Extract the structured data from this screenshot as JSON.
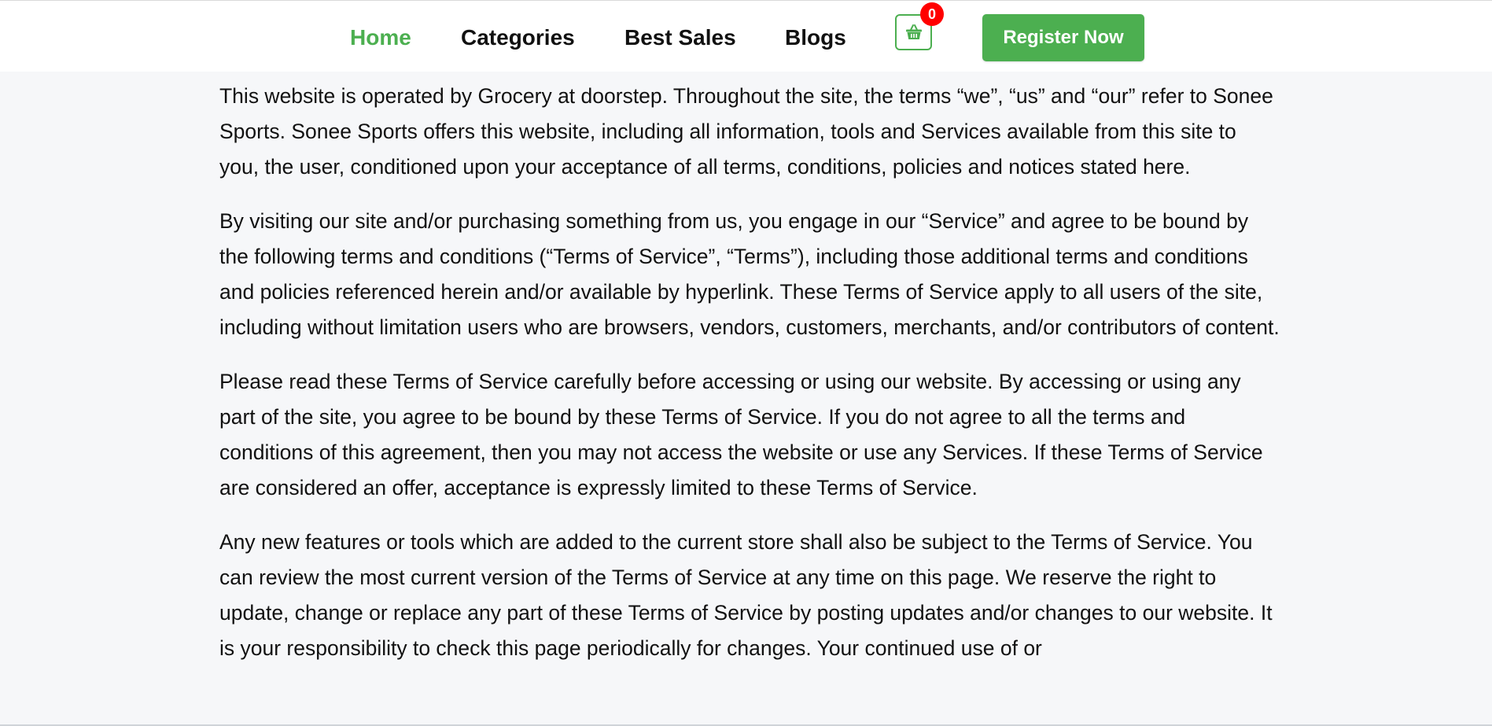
{
  "nav": {
    "items": [
      {
        "label": "Home",
        "active": true
      },
      {
        "label": "Categories",
        "active": false
      },
      {
        "label": "Best Sales",
        "active": false
      },
      {
        "label": "Blogs",
        "active": false
      }
    ],
    "cart": {
      "icon": "basket-icon",
      "count": "0"
    },
    "register_label": "Register Now"
  },
  "colors": {
    "accent": "#4caf50",
    "badge": "#ff0000",
    "background": "#f6f7f9"
  },
  "terms": {
    "paragraphs": [
      "This website is operated by Grocery at doorstep. Throughout the site, the terms “we”, “us” and “our” refer to Sonee Sports. Sonee Sports offers this website, including all information, tools and Services available from this site to you, the user, conditioned upon your acceptance of all terms, conditions, policies and notices stated here.",
      "By visiting our site and/or purchasing something from us, you engage in our “Service” and agree to be bound by the following terms and conditions (“Terms of Service”, “Terms”), including those additional terms and conditions and policies referenced herein and/or available by hyperlink. These Terms of Service apply to all users of the site, including without limitation users who are browsers, vendors, customers, merchants, and/or contributors of content.",
      "Please read these Terms of Service carefully before accessing or using our website. By accessing or using any part of the site, you agree to be bound by these Terms of Service. If you do not agree to all the terms and conditions of this agreement, then you may not access the website or use any Services. If these Terms of Service are considered an offer, acceptance is expressly limited to these Terms of Service.",
      "Any new features or tools which are added to the current store shall also be subject to the Terms of Service. You can review the most current version of the Terms of Service at any time on this page. We reserve the right to update, change or replace any part of these Terms of Service by posting updates and/or changes to our website. It is your responsibility to check this page periodically for changes. Your continued use of or"
    ]
  }
}
